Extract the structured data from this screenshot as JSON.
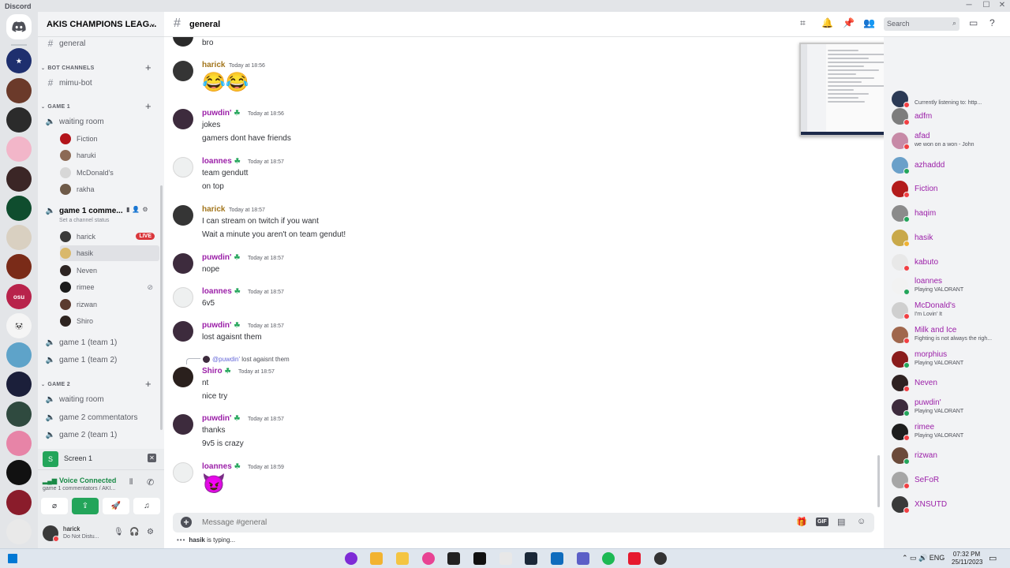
{
  "window": {
    "title": "Discord"
  },
  "guild": {
    "name": "AKIS CHAMPIONS LEAG..."
  },
  "channels": {
    "general": "general",
    "cat_bot": "BOT CHANNELS",
    "mimu": "mimu-bot",
    "cat_game1": "GAME 1",
    "waiting1": "waiting room",
    "waiting_users": [
      "Fiction",
      "haruki",
      "McDonald's",
      "rakha"
    ],
    "commentators": "game 1 comme...",
    "set_status": "Set a channel status",
    "live_badge": "LIVE",
    "commentator_users": [
      "harick",
      "hasik",
      "Neven",
      "rimee",
      "rizwan",
      "Shiro"
    ],
    "team1": "game 1 (team 1)",
    "team2": "game 1 (team 2)",
    "cat_game2": "GAME 2",
    "waiting2": "waiting room",
    "g2_commentators": "game 2 commentators",
    "g2_team1": "game 2 (team 1)"
  },
  "screen_share": {
    "label": "Screen 1"
  },
  "voice": {
    "status": "Voice Connected",
    "channel": "game 1 commentators / AKI..."
  },
  "user": {
    "name": "harick",
    "status": "Do Not Distu..."
  },
  "header": {
    "channel": "general",
    "search_placeholder": "Search"
  },
  "messages": [
    {
      "text": "bro"
    },
    {
      "author": "harick",
      "time": "Today at 18:56",
      "color": "#a2751b",
      "emoji": "😂😂"
    },
    {
      "author": "puwdin'",
      "time": "Today at 18:56",
      "color": "#9b1fa8",
      "lines": [
        "jokes",
        "gamers dont have friends"
      ]
    },
    {
      "author": "loannes",
      "time": "Today at 18:57",
      "color": "#9b1fa8",
      "lines": [
        "team gendutt",
        "on top"
      ]
    },
    {
      "author": "harick",
      "time": "Today at 18:57",
      "color": "#a2751b",
      "lines": [
        "I can stream on twitch if you want",
        "Wait a minute you aren't on team gendut!"
      ]
    },
    {
      "author": "puwdin'",
      "time": "Today at 18:57",
      "color": "#9b1fa8",
      "lines": [
        "nope"
      ]
    },
    {
      "author": "loannes",
      "time": "Today at 18:57",
      "color": "#9b1fa8",
      "lines": [
        "6v5"
      ]
    },
    {
      "author": "puwdin'",
      "time": "Today at 18:57",
      "color": "#9b1fa8",
      "lines": [
        "lost agaisnt them"
      ]
    },
    {
      "reply_mention": "@puwdin'",
      "reply_text": "lost agaisnt them",
      "author": "Shiro",
      "time": "Today at 18:57",
      "color": "#9b1fa8",
      "lines": [
        "nt",
        "nice try"
      ]
    },
    {
      "author": "puwdin'",
      "time": "Today at 18:57",
      "color": "#9b1fa8",
      "lines": [
        "thanks",
        "9v5 is crazy"
      ]
    },
    {
      "author": "loannes",
      "time": "Today at 18:59",
      "color": "#9b1fa8",
      "emoji": "😈"
    }
  ],
  "composer": {
    "placeholder": "Message #general",
    "gif": "GIF"
  },
  "typing": {
    "user": "hasik",
    "text": "is typing..."
  },
  "preview_fragment": "NT",
  "members": [
    {
      "name": "",
      "sub": "Currently listening to: http...",
      "color": "#9b1fa8",
      "status": "dnd"
    },
    {
      "name": "adfm",
      "sub": "",
      "color": "#9b1fa8",
      "status": "dnd"
    },
    {
      "name": "afad",
      "sub": "we won on a won - John",
      "color": "#9b1fa8",
      "status": "dnd"
    },
    {
      "name": "azhaddd",
      "sub": "",
      "color": "#9b1fa8",
      "status": "online"
    },
    {
      "name": "Fiction",
      "sub": "",
      "color": "#9b1fa8",
      "status": "dnd"
    },
    {
      "name": "haqim",
      "sub": "",
      "color": "#9b1fa8",
      "status": "online"
    },
    {
      "name": "hasik",
      "sub": "",
      "color": "#9b1fa8",
      "status": "idle"
    },
    {
      "name": "kabuto",
      "sub": "",
      "color": "#9b1fa8",
      "status": "dnd"
    },
    {
      "name": "loannes",
      "sub": "Playing VALORANT",
      "color": "#9b1fa8",
      "status": "online"
    },
    {
      "name": "McDonald's",
      "sub": "I'm Lovin' It",
      "color": "#9b1fa8",
      "status": "dnd"
    },
    {
      "name": "Milk and Ice",
      "sub": "Fighting is not always the righ...",
      "color": "#9b1fa8",
      "status": "dnd"
    },
    {
      "name": "morphius",
      "sub": "Playing VALORANT",
      "color": "#9b1fa8",
      "status": "online"
    },
    {
      "name": "Neven",
      "sub": "",
      "color": "#9b1fa8",
      "status": "dnd"
    },
    {
      "name": "puwdin'",
      "sub": "Playing VALORANT",
      "color": "#9b1fa8",
      "status": "online"
    },
    {
      "name": "rimee",
      "sub": "Playing VALORANT",
      "color": "#9b1fa8",
      "status": "dnd"
    },
    {
      "name": "rizwan",
      "sub": "",
      "color": "#9b1fa8",
      "status": "online"
    },
    {
      "name": "SeFoR",
      "sub": "",
      "color": "#9b1fa8",
      "status": "dnd"
    },
    {
      "name": "XNSUTD",
      "sub": "",
      "color": "#9b1fa8",
      "status": "dnd"
    }
  ],
  "taskbar": {
    "lang": "ENG",
    "time": "07:32 PM",
    "date": "25/11/2023"
  },
  "icons": {
    "rail_home": "discord-logo-icon",
    "hash": "hash-icon",
    "speaker": "speaker-icon",
    "threads": "threads-icon",
    "bell": "bell-icon",
    "pin": "pin-icon",
    "members": "members-icon",
    "inbox": "inbox-icon",
    "help": "help-icon",
    "gift": "gift-icon",
    "sticker": "sticker-icon",
    "emoji": "emoji-icon",
    "mic": "mic-icon",
    "headphones": "headphones-icon",
    "settings": "gear-icon"
  },
  "colors": {
    "accent_green": "#23a55a",
    "dnd_red": "#f23f43",
    "idle_yellow": "#f0b232",
    "blurple": "#5865f2",
    "role_purple": "#9b1fa8",
    "role_gold": "#a2751b"
  }
}
